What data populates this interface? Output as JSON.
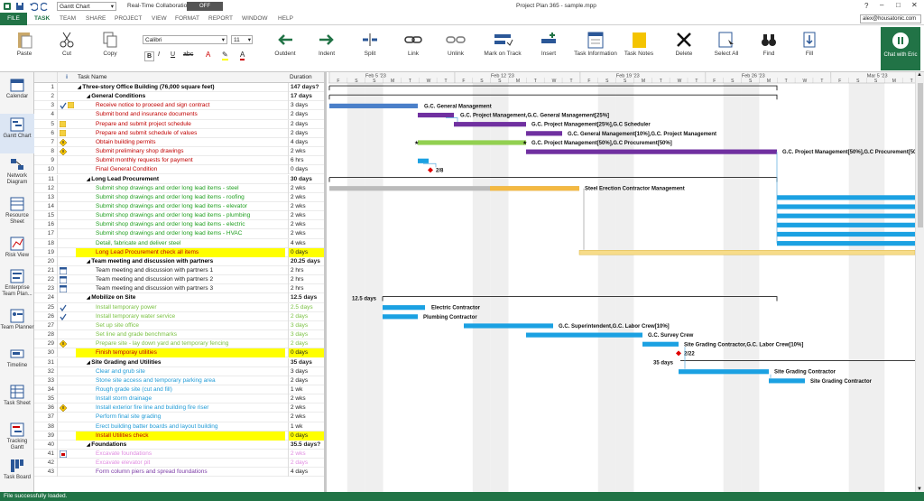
{
  "window": {
    "title": "Project Plan 365 - sample.mpp",
    "view_selector": "Gantt Chart",
    "realtime_label": "Real-Time Collaboration",
    "realtime_state": "OFF",
    "user": "alex@housatonic.com",
    "help": "?"
  },
  "tabs": [
    "FILE",
    "TASK",
    "TEAM",
    "SHARE",
    "PROJECT",
    "VIEW",
    "FORMAT",
    "REPORT",
    "WINDOW",
    "HELP"
  ],
  "ribbon": {
    "paste": "Paste",
    "cut": "Cut",
    "copy": "Copy",
    "font": "Calibri",
    "font_size": "11",
    "outdent": "Outdent",
    "indent": "Indent",
    "split": "Split",
    "link": "Link",
    "unlink": "Unlink",
    "mark_on_track": "Mark on Track",
    "insert": "Insert",
    "task_information": "Task Information",
    "task_notes": "Task Notes",
    "delete": "Delete",
    "select_all": "Select All",
    "find": "Find",
    "fill": "Fill",
    "chat": "Chat with Eric"
  },
  "views": [
    "Calendar",
    "Gantt Chart",
    "Network Diagram",
    "Resource Sheet",
    "Risk View",
    "Enterprise Team Plan...",
    "Team Planner",
    "Timeline",
    "Task Sheet",
    "Tracking Gantt",
    "Task Board"
  ],
  "columns": {
    "info": "i",
    "task_name": "Task Name",
    "duration": "Duration"
  },
  "timescale": {
    "weeks": [
      "Feb 5 '23",
      "Feb 12 '23",
      "Feb 19 '23",
      "Feb 26 '23",
      "Mar 5 '23"
    ],
    "days": [
      "F",
      "S",
      "S",
      "M",
      "T",
      "W",
      "T",
      "F",
      "S",
      "S",
      "M",
      "T",
      "W",
      "T",
      "F",
      "S",
      "S",
      "M",
      "T",
      "W",
      "T",
      "F",
      "S",
      "S",
      "M",
      "T",
      "W",
      "T",
      "F",
      "S",
      "S",
      "M",
      "T",
      "W"
    ]
  },
  "tasks": [
    {
      "id": "1",
      "name": "Three-story Office Building (76,000 square feet)",
      "dur": "147 days?",
      "lvl": 0,
      "sum": true,
      "color": "#000000"
    },
    {
      "id": "2",
      "name": "General Conditions",
      "dur": "17 days",
      "lvl": 1,
      "sum": true,
      "color": "#000000"
    },
    {
      "id": "3",
      "name": "Receive notice to proceed and sign contract",
      "dur": "3 days",
      "lvl": 2,
      "color": "#c00000",
      "icon": "check-note"
    },
    {
      "id": "4",
      "name": "Submit bond and insurance documents",
      "dur": "2 days",
      "lvl": 2,
      "color": "#c00000"
    },
    {
      "id": "5",
      "name": "Prepare and submit project schedule",
      "dur": "2 days",
      "lvl": 2,
      "color": "#c00000",
      "icon": "note"
    },
    {
      "id": "6",
      "name": "Prepare and submit schedule of values",
      "dur": "2 days",
      "lvl": 2,
      "color": "#c00000",
      "icon": "note"
    },
    {
      "id": "7",
      "name": "Obtain building permits",
      "dur": "4 days",
      "lvl": 2,
      "color": "#c00000",
      "icon": "warn"
    },
    {
      "id": "8",
      "name": "Submit preliminary shop drawings",
      "dur": "2 wks",
      "lvl": 2,
      "color": "#c00000",
      "icon": "warn"
    },
    {
      "id": "9",
      "name": "Submit monthly requests for payment",
      "dur": "6 hrs",
      "lvl": 2,
      "color": "#c00000"
    },
    {
      "id": "10",
      "name": "Final General Condition",
      "dur": "0 days",
      "lvl": 2,
      "color": "#c00000"
    },
    {
      "id": "11",
      "name": "Long Lead Procurement",
      "dur": "30 days",
      "lvl": 1,
      "sum": true,
      "color": "#000000"
    },
    {
      "id": "12",
      "name": "Submit shop drawings and order long lead items - steel",
      "dur": "2 wks",
      "lvl": 2,
      "color": "#1e9e1e"
    },
    {
      "id": "13",
      "name": "Submit shop drawings and order long lead items - roofing",
      "dur": "2 wks",
      "lvl": 2,
      "color": "#1e9e1e"
    },
    {
      "id": "14",
      "name": "Submit shop drawings and order long lead items - elevator",
      "dur": "2 wks",
      "lvl": 2,
      "color": "#1e9e1e"
    },
    {
      "id": "15",
      "name": "Submit shop drawings and order long lead items - plumbing",
      "dur": "2 wks",
      "lvl": 2,
      "color": "#1e9e1e"
    },
    {
      "id": "16",
      "name": "Submit shop drawings and order long lead items - electric",
      "dur": "2 wks",
      "lvl": 2,
      "color": "#1e9e1e"
    },
    {
      "id": "17",
      "name": "Submit shop drawings and order long lead items - HVAC",
      "dur": "2 wks",
      "lvl": 2,
      "color": "#1e9e1e"
    },
    {
      "id": "18",
      "name": "Detail, fabricate and deliver steel",
      "dur": "4 wks",
      "lvl": 2,
      "color": "#1e9e1e"
    },
    {
      "id": "19",
      "name": "Long Lead Procurement check all items",
      "dur": "0 days",
      "lvl": 2,
      "color": "#c00000",
      "hl": true
    },
    {
      "id": "20",
      "name": "Team meeting and discussion with partners",
      "dur": "20.25 days",
      "lvl": 1,
      "sum": true,
      "color": "#000000"
    },
    {
      "id": "21",
      "name": "Team meeting and discussion with partners 1",
      "dur": "2 hrs",
      "lvl": 2,
      "color": "#222222",
      "icon": "cal"
    },
    {
      "id": "22",
      "name": "Team meeting and discussion with partners 2",
      "dur": "2 hrs",
      "lvl": 2,
      "color": "#222222",
      "icon": "cal"
    },
    {
      "id": "23",
      "name": "Team meeting and discussion with partners 3",
      "dur": "2 hrs",
      "lvl": 2,
      "color": "#222222",
      "icon": "cal"
    },
    {
      "id": "24",
      "name": "Mobilize on Site",
      "dur": "12.5 days",
      "lvl": 1,
      "sum": true,
      "color": "#000000"
    },
    {
      "id": "25",
      "name": "Install temporary power",
      "dur": "2.5 days",
      "lvl": 2,
      "color": "#7ac142",
      "icon": "check"
    },
    {
      "id": "26",
      "name": "Install temporary water service",
      "dur": "2 days",
      "lvl": 2,
      "color": "#7ac142",
      "icon": "check"
    },
    {
      "id": "27",
      "name": "Set up site office",
      "dur": "3 days",
      "lvl": 2,
      "color": "#7ac142"
    },
    {
      "id": "28",
      "name": "Set line and grade benchmarks",
      "dur": "3 days",
      "lvl": 2,
      "color": "#7ac142"
    },
    {
      "id": "29",
      "name": "Prepare site - lay down yard and temporary fencing",
      "dur": "2 days",
      "lvl": 2,
      "color": "#7ac142",
      "icon": "warn"
    },
    {
      "id": "30",
      "name": "Finish temporay utilities",
      "dur": "0 days",
      "lvl": 2,
      "color": "#c00000",
      "hl": true
    },
    {
      "id": "31",
      "name": "Site Grading and Utilities",
      "dur": "35 days",
      "lvl": 1,
      "sum": true,
      "color": "#000000"
    },
    {
      "id": "32",
      "name": "Clear and grub site",
      "dur": "3 days",
      "lvl": 2,
      "color": "#1f9ad6"
    },
    {
      "id": "33",
      "name": "Stone site access and temporary parking area",
      "dur": "2 days",
      "lvl": 2,
      "color": "#1f9ad6"
    },
    {
      "id": "34",
      "name": "Rough grade site (cut and fill)",
      "dur": "1 wk",
      "lvl": 2,
      "color": "#1f9ad6"
    },
    {
      "id": "35",
      "name": "Install storm drainage",
      "dur": "2 wks",
      "lvl": 2,
      "color": "#1f9ad6"
    },
    {
      "id": "36",
      "name": "Install exterior fire line and building fire riser",
      "dur": "2 wks",
      "lvl": 2,
      "color": "#1f9ad6",
      "icon": "warn"
    },
    {
      "id": "37",
      "name": "Perform final site grading",
      "dur": "2 wks",
      "lvl": 2,
      "color": "#1f9ad6"
    },
    {
      "id": "38",
      "name": "Erect building batter boards and layout building",
      "dur": "1 wk",
      "lvl": 2,
      "color": "#1f9ad6"
    },
    {
      "id": "39",
      "name": "Install Utilities check",
      "dur": "0 days",
      "lvl": 2,
      "color": "#c00000",
      "hl": true
    },
    {
      "id": "40",
      "name": "Foundations",
      "dur": "35.5 days?",
      "lvl": 1,
      "sum": true,
      "color": "#000000"
    },
    {
      "id": "41",
      "name": "Excavate foundations",
      "dur": "2 wks",
      "lvl": 2,
      "color": "#e08ce0",
      "icon": "red"
    },
    {
      "id": "42",
      "name": "Excavate elevator pit",
      "dur": "2 days",
      "lvl": 2,
      "color": "#e08ce0"
    },
    {
      "id": "43",
      "name": "Form column piers and spread foundations",
      "dur": "4 days",
      "lvl": 2,
      "color": "#7b3aa6"
    }
  ],
  "gantt_labels": {
    "r3": "G.C. General Management",
    "r4": "G.C. Project Management,G.C. General Management[25%]",
    "r5": "G.C. Project Management[25%],G.C Scheduler",
    "r6": "G.C. General Management[10%],G.C. Project Management",
    "r7": "G.C. Project Management[50%],G.C Procurement[50%]",
    "r8": "G.C. Project Management[50%],G.C Procurement[50%]",
    "r10": "2/8",
    "r12": "Steel Erection Contractor Management",
    "r24": "12.5 days",
    "r25": "Electric Contractor",
    "r26": "Plumbing Contractor",
    "r27": "G.C. Superintendent,G.C. Labor Crew[10%]",
    "r28": "G.C. Survey Crew",
    "r29": "Site Grading Contractor,G.C. Labor Crew[10%]",
    "r30": "2/22",
    "r31": "35 days",
    "r32": "Site Grading Contractor",
    "r33": "Site Grading Contractor"
  },
  "colors": {
    "accent": "#217346",
    "summary": "#000000",
    "purple": "#7030a0",
    "blue": "#1ba1e2",
    "green_bar": "#92d050",
    "orange": "#f4b942"
  },
  "status": "File successfully loaded."
}
